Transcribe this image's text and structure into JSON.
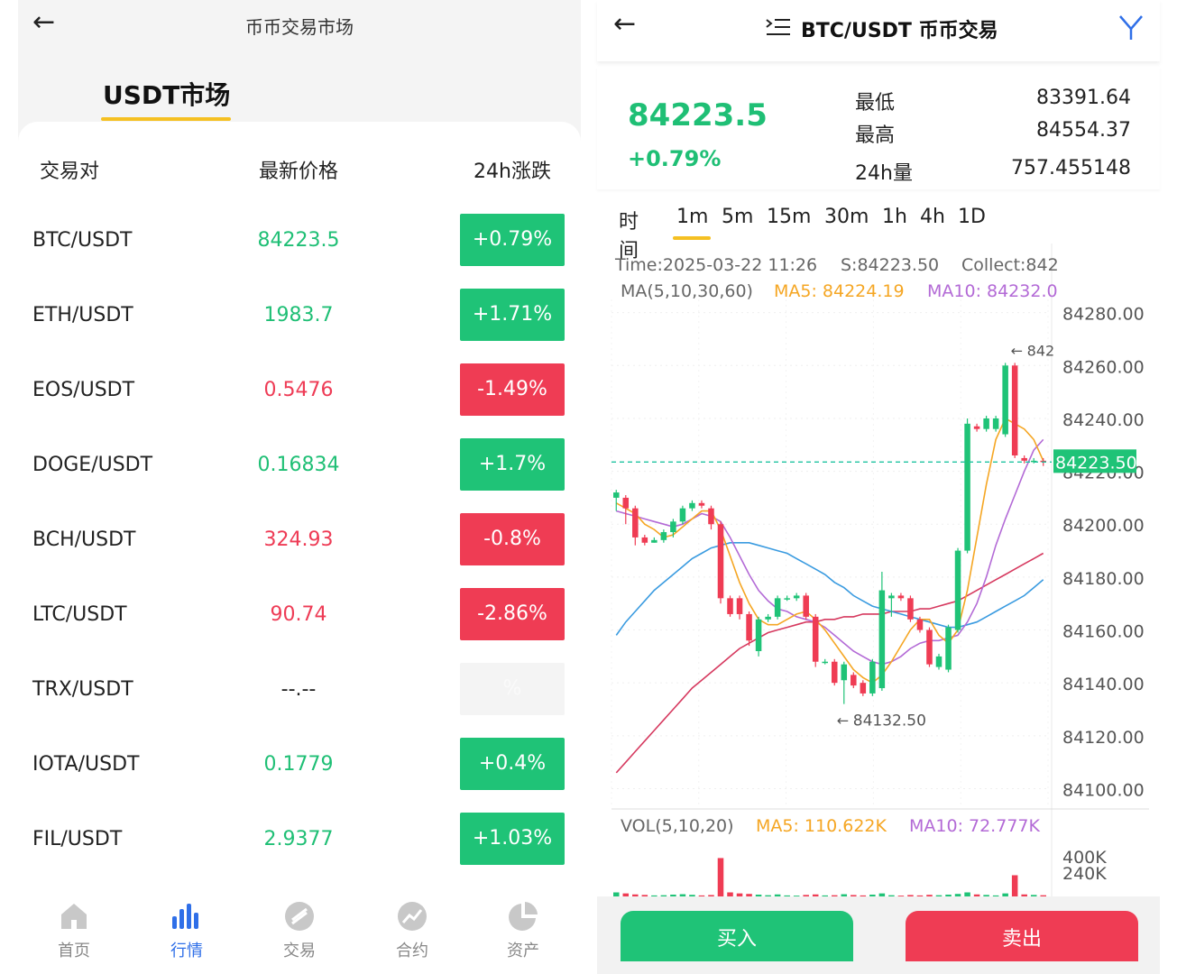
{
  "left": {
    "title": "币币交易市场",
    "market_tab": "USDT市场",
    "columns": [
      "交易对",
      "最新价格",
      "24h涨跌"
    ],
    "rows": [
      {
        "pair": "BTC/USDT",
        "price": "84223.5",
        "change": "+0.79%",
        "trend": "up"
      },
      {
        "pair": "ETH/USDT",
        "price": "1983.7",
        "change": "+1.71%",
        "trend": "up"
      },
      {
        "pair": "EOS/USDT",
        "price": "0.5476",
        "change": "-1.49%",
        "trend": "down"
      },
      {
        "pair": "DOGE/USDT",
        "price": "0.16834",
        "change": "+1.7%",
        "trend": "up"
      },
      {
        "pair": "BCH/USDT",
        "price": "324.93",
        "change": "-0.8%",
        "trend": "down"
      },
      {
        "pair": "LTC/USDT",
        "price": "90.74",
        "change": "-2.86%",
        "trend": "down"
      },
      {
        "pair": "TRX/USDT",
        "price": "--.--",
        "change": "%",
        "trend": "flat"
      },
      {
        "pair": "IOTA/USDT",
        "price": "0.1779",
        "change": "+0.4%",
        "trend": "up"
      },
      {
        "pair": "FIL/USDT",
        "price": "2.9377",
        "change": "+1.03%",
        "trend": "up"
      }
    ],
    "nav": [
      {
        "label": "首页",
        "icon": "home-icon"
      },
      {
        "label": "行情",
        "icon": "market-bars-icon",
        "active": true
      },
      {
        "label": "交易",
        "icon": "trade-icon"
      },
      {
        "label": "合约",
        "icon": "contract-icon"
      },
      {
        "label": "资产",
        "icon": "assets-pie-icon"
      }
    ]
  },
  "right": {
    "title": "BTC/USDT 币币交易",
    "last_price": "84223.5",
    "change": "+0.79%",
    "stats": [
      {
        "label": "最低",
        "value": "83391.64"
      },
      {
        "label": "最高",
        "value": "84554.37"
      },
      {
        "label": "24h量",
        "value": "757.455148"
      }
    ],
    "periods": [
      "时间",
      "1m",
      "5m",
      "15m",
      "30m",
      "1h",
      "4h",
      "1D"
    ],
    "active_period": "1m",
    "info_line": {
      "time": "Time:2025-03-22 11:26",
      "s": "S:84223.50",
      "collect": "Collect:842"
    },
    "ma_line": {
      "label": "MA(5,10,30,60)",
      "ma5": "MA5: 84224.19",
      "ma10": "MA10: 84232.0"
    },
    "vol_line": {
      "label": "VOL(5,10,20)",
      "ma5": "MA5: 110.622K",
      "ma10": "MA10: 72.777K"
    },
    "low_marker": "84132.50",
    "high_marker": "842",
    "current_tag": "84223.50",
    "buy_label": "买入",
    "sell_label": "卖出",
    "colors": {
      "up": "#1fc377",
      "down": "#ef3c54",
      "ma5": "#f5a623",
      "ma10": "#b36ad6",
      "ma30": "#3a9be0",
      "ma60": "#d6395f",
      "accent": "#f5c022"
    }
  },
  "chart_data": {
    "type": "candlestick",
    "y_ticks": [
      "84280.00",
      "84260.00",
      "84240.00",
      "84220.00",
      "84200.00",
      "84180.00",
      "84160.00",
      "84140.00",
      "84120.00",
      "84100.00"
    ],
    "ylim": [
      84093,
      84285
    ],
    "vol_ticks": [
      "400K",
      "240K"
    ],
    "vol_ylim": [
      0,
      500
    ],
    "current_price": 84223.5,
    "candles": [
      {
        "o": 84210,
        "c": 84212,
        "h": 84213,
        "l": 84205
      },
      {
        "o": 84210,
        "c": 84206,
        "h": 84211,
        "l": 84200
      },
      {
        "o": 84206,
        "c": 84195,
        "h": 84207,
        "l": 84192
      },
      {
        "o": 84195,
        "c": 84193,
        "h": 84196,
        "l": 84192
      },
      {
        "o": 84193,
        "c": 84194,
        "h": 84195,
        "l": 84193
      },
      {
        "o": 84194,
        "c": 84197,
        "h": 84198,
        "l": 84193
      },
      {
        "o": 84197,
        "c": 84201,
        "h": 84202,
        "l": 84195
      },
      {
        "o": 84201,
        "c": 84206,
        "h": 84207,
        "l": 84200
      },
      {
        "o": 84206,
        "c": 84208,
        "h": 84209,
        "l": 84205
      },
      {
        "o": 84208,
        "c": 84207,
        "h": 84209,
        "l": 84206
      },
      {
        "o": 84206,
        "c": 84200,
        "h": 84207,
        "l": 84198
      },
      {
        "o": 84200,
        "c": 84172,
        "h": 84201,
        "l": 84170
      },
      {
        "o": 84172,
        "c": 84166,
        "h": 84173,
        "l": 84165
      },
      {
        "o": 84172,
        "c": 84166,
        "h": 84173,
        "l": 84164
      },
      {
        "o": 84166,
        "c": 84156,
        "h": 84167,
        "l": 84154
      },
      {
        "o": 84152,
        "c": 84164,
        "h": 84165,
        "l": 84150
      },
      {
        "o": 84164,
        "c": 84165,
        "h": 84166,
        "l": 84163
      },
      {
        "o": 84165,
        "c": 84172,
        "h": 84173,
        "l": 84164
      },
      {
        "o": 84172,
        "c": 84172,
        "h": 84173,
        "l": 84171
      },
      {
        "o": 84172,
        "c": 84173,
        "h": 84174,
        "l": 84171
      },
      {
        "o": 84173,
        "c": 84165,
        "h": 84174,
        "l": 84164
      },
      {
        "o": 84165,
        "c": 84148,
        "h": 84166,
        "l": 84146
      },
      {
        "o": 84148,
        "c": 84148,
        "h": 84149,
        "l": 84147
      },
      {
        "o": 84148,
        "c": 84140,
        "h": 84149,
        "l": 84139
      },
      {
        "o": 84141,
        "c": 84147,
        "h": 84148,
        "l": 84132
      },
      {
        "o": 84143,
        "c": 84139,
        "h": 84144,
        "l": 84138
      },
      {
        "o": 84140,
        "c": 84136,
        "h": 84141,
        "l": 84135
      },
      {
        "o": 84136,
        "c": 84148,
        "h": 84149,
        "l": 84135
      },
      {
        "o": 84138,
        "c": 84175,
        "h": 84182,
        "l": 84137
      },
      {
        "o": 84172,
        "c": 84173,
        "h": 84174,
        "l": 84165
      },
      {
        "o": 84173,
        "c": 84172,
        "h": 84174,
        "l": 84171
      },
      {
        "o": 84172,
        "c": 84164,
        "h": 84173,
        "l": 84163
      },
      {
        "o": 84164,
        "c": 84160,
        "h": 84165,
        "l": 84159
      },
      {
        "o": 84160,
        "c": 84147,
        "h": 84161,
        "l": 84146
      },
      {
        "o": 84146,
        "c": 84150,
        "h": 84151,
        "l": 84145
      },
      {
        "o": 84145,
        "c": 84161,
        "h": 84162,
        "l": 84144
      },
      {
        "o": 84160,
        "c": 84190,
        "h": 84191,
        "l": 84159
      },
      {
        "o": 84190,
        "c": 84238,
        "h": 84240,
        "l": 84189
      },
      {
        "o": 84237,
        "c": 84236,
        "h": 84238,
        "l": 84235
      },
      {
        "o": 84236,
        "c": 84240,
        "h": 84241,
        "l": 84235
      },
      {
        "o": 84236,
        "c": 84240,
        "h": 84241,
        "l": 84235
      },
      {
        "o": 84234,
        "c": 84260,
        "h": 84261,
        "l": 84233
      },
      {
        "o": 84260,
        "c": 84226,
        "h": 84261,
        "l": 84225
      },
      {
        "o": 84225,
        "c": 84224,
        "h": 84226,
        "l": 84223
      },
      {
        "o": 84224,
        "c": 84224,
        "h": 84225,
        "l": 84223
      },
      {
        "o": 84224,
        "c": 84223.5,
        "h": 84225,
        "l": 84222
      }
    ],
    "ma5": [
      84208,
      84206,
      84204,
      84200,
      84198,
      84195,
      84196,
      84199,
      84202,
      84205,
      84205,
      84198,
      84188,
      84178,
      84170,
      84164,
      84162,
      84162,
      84164,
      84166,
      84167,
      84164,
      84160,
      84155,
      84150,
      84145,
      84142,
      84140,
      84143,
      84148,
      84154,
      84160,
      84164,
      84164,
      84158,
      84155,
      84160,
      84175,
      84195,
      84215,
      84232,
      84240,
      84238,
      84236,
      84232,
      84224
    ],
    "ma10": [
      84205,
      84204,
      84203,
      84202,
      84201,
      84200,
      84199,
      84200,
      84202,
      84204,
      84203,
      84201,
      84195,
      84188,
      84181,
      84175,
      84171,
      84168,
      84167,
      84165,
      84164,
      84163,
      84161,
      84158,
      84155,
      84152,
      84150,
      84148,
      84147,
      84148,
      84150,
      84153,
      84155,
      84156,
      84156,
      84157,
      84158,
      84163,
      84170,
      84180,
      84192,
      84202,
      84211,
      84220,
      84228,
      84232
    ],
    "ma30": [
      84158,
      84163,
      84167,
      84171,
      84175,
      84178,
      84181,
      84184,
      84187,
      84189,
      84191,
      84192,
      84193,
      84193,
      84193,
      84192,
      84191,
      84190,
      84189,
      84187,
      84185,
      84183,
      84181,
      84178,
      84176,
      84173,
      84171,
      84169,
      84168,
      84167,
      84166,
      84165,
      84164,
      84163,
      84162,
      84161,
      84161,
      84162,
      84163,
      84165,
      84167,
      84169,
      84171,
      84173,
      84176,
      84179
    ],
    "ma60": [
      84106,
      84110,
      84114,
      84118,
      84122,
      84126,
      84130,
      84134,
      84138,
      84141,
      84144,
      84147,
      84150,
      84153,
      84155,
      84157,
      84159,
      84160,
      84161,
      84162,
      84163,
      84163,
      84164,
      84164,
      84165,
      84165,
      84166,
      84166,
      84166,
      84167,
      84167,
      84167,
      84168,
      84168,
      84169,
      84170,
      84171,
      84173,
      84175,
      84177,
      84179,
      84181,
      84183,
      84185,
      84187,
      84189
    ],
    "volume": [
      40,
      30,
      20,
      15,
      10,
      12,
      18,
      22,
      16,
      10,
      14,
      380,
      40,
      30,
      25,
      18,
      12,
      20,
      10,
      8,
      15,
      20,
      10,
      12,
      22,
      14,
      10,
      18,
      30,
      12,
      8,
      14,
      10,
      16,
      12,
      18,
      25,
      40,
      20,
      15,
      10,
      30,
      210,
      20,
      15,
      12
    ]
  }
}
